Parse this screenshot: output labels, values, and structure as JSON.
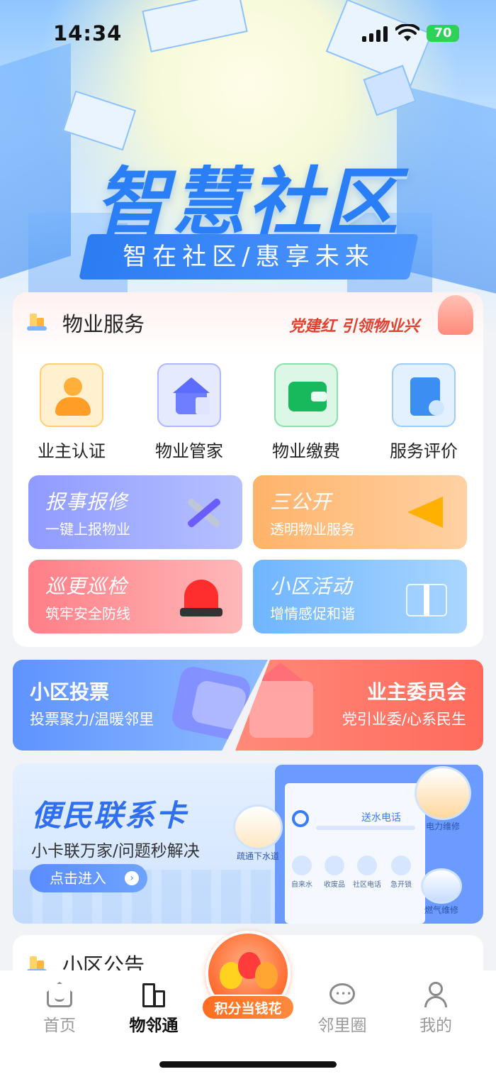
{
  "status_bar": {
    "time": "14:34",
    "battery": "70"
  },
  "hero": {
    "title": "智慧社区",
    "slogan": "智在社区/惠享未来"
  },
  "property": {
    "title": "物业服务",
    "slogan": "党建红 引领物业兴",
    "services": [
      {
        "label": "业主认证",
        "icon": "owner-verify-icon"
      },
      {
        "label": "物业管家",
        "icon": "property-steward-icon"
      },
      {
        "label": "物业缴费",
        "icon": "wallet-icon"
      },
      {
        "label": "服务评价",
        "icon": "rating-book-icon"
      }
    ],
    "features": [
      {
        "title": "报事报修",
        "subtitle": "一键上报物业",
        "icon": "tools-icon"
      },
      {
        "title": "三公开",
        "subtitle": "透明物业服务",
        "icon": "megaphone-icon"
      },
      {
        "title": "巡更巡检",
        "subtitle": "筑牢安全防线",
        "icon": "siren-icon"
      },
      {
        "title": "小区活动",
        "subtitle": "增情感促和谐",
        "icon": "gift-icon"
      }
    ]
  },
  "vote": {
    "title": "小区投票",
    "subtitle": "投票聚力/温暖邻里"
  },
  "committee": {
    "title": "业主委员会",
    "subtitle": "党引业委/心系民生"
  },
  "contact_card": {
    "title": "便民联系卡",
    "subtitle": "小卡联万家/问题秒解决",
    "button": "点击进入",
    "search_label": "送水电话",
    "mini_items": [
      "自来水",
      "收废品",
      "社区电话",
      "急开锁"
    ],
    "bubbles": [
      "疏通下水道",
      "电力维修",
      "燃气维修"
    ]
  },
  "notice": {
    "title": "小区公告"
  },
  "tabbar": {
    "items": [
      {
        "label": "首页",
        "icon": "home-icon"
      },
      {
        "label": "物邻通",
        "icon": "building-icon",
        "active": true
      },
      {
        "label": "邻里圈",
        "icon": "chat-icon"
      },
      {
        "label": "我的",
        "icon": "profile-icon"
      }
    ],
    "points_label": "积分当钱花"
  },
  "colors": {
    "accent_blue": "#2a7ef6",
    "party_red": "#e34130",
    "points_orange": "#ff6d1f"
  }
}
